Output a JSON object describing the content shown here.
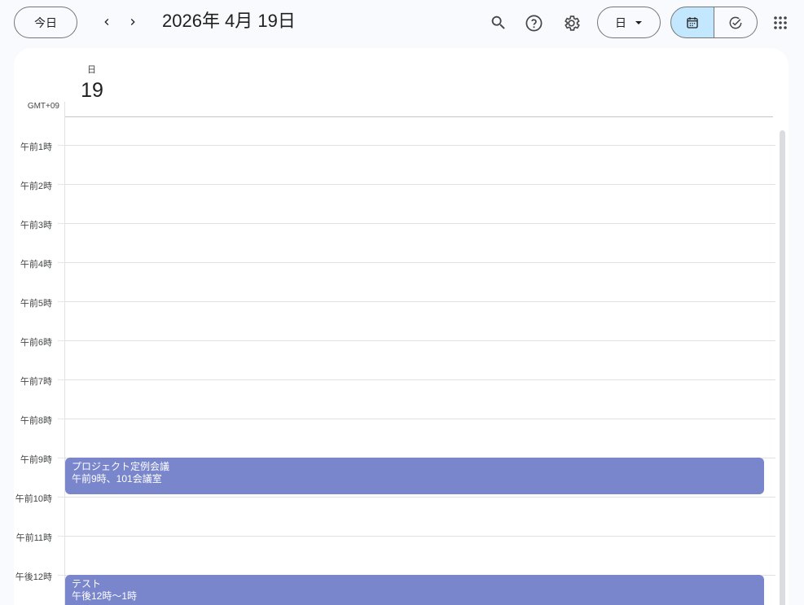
{
  "header": {
    "today_label": "今日",
    "date_title": "2026年 4月 19日",
    "view_select_label": "日"
  },
  "day": {
    "weekday": "日",
    "date": "19",
    "timezone": "GMT+09"
  },
  "hours": [
    "午前1時",
    "午前2時",
    "午前3時",
    "午前4時",
    "午前5時",
    "午前6時",
    "午前7時",
    "午前8時",
    "午前9時",
    "午前10時",
    "午前11時",
    "午後12時"
  ],
  "events": [
    {
      "title": "プロジェクト定例会議",
      "detail": "午前9時、101会議室"
    },
    {
      "title": "テスト",
      "detail": "午後12時～1時"
    }
  ],
  "colors": {
    "event": "#7986cb",
    "selected_view": "#c2e7ff"
  },
  "icons": [
    "chevron-left-icon",
    "chevron-right-icon",
    "search-icon",
    "help-icon",
    "gear-icon",
    "dropdown-arrow-icon",
    "calendar-icon",
    "task-check-icon",
    "apps-grid-icon"
  ]
}
